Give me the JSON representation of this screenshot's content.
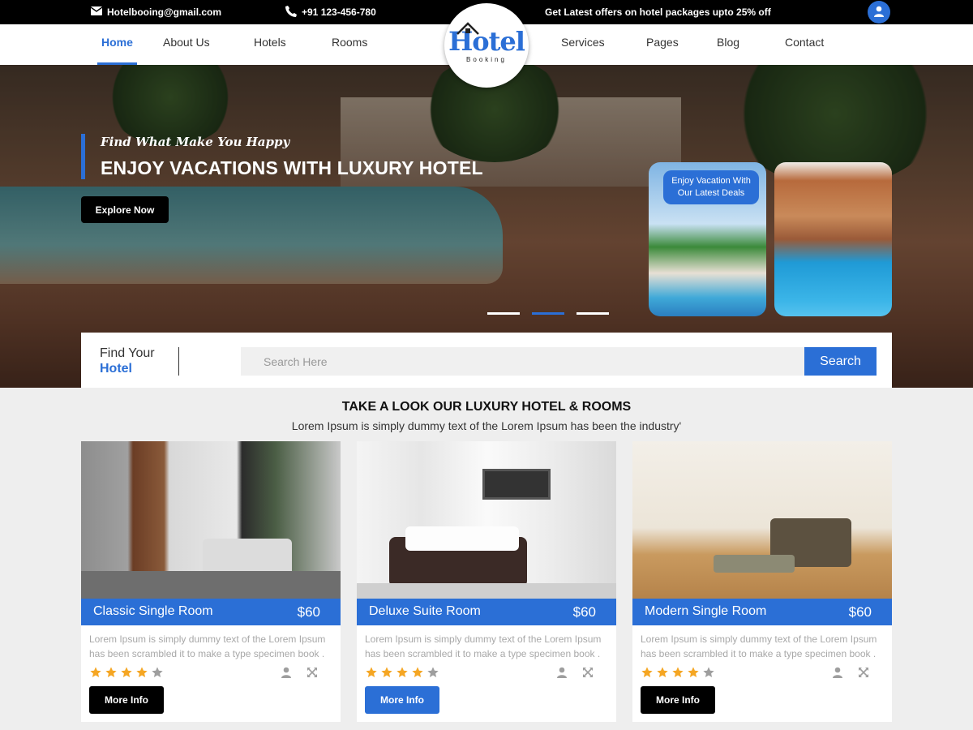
{
  "topbar": {
    "email": "Hotelbooing@gmail.com",
    "phone": "+91 123-456-780",
    "offer": "Get Latest offers on hotel packages upto 25% off"
  },
  "nav": {
    "items": [
      "Home",
      "About Us",
      "Hotels",
      "Rooms",
      "Services",
      "Pages",
      "Blog",
      "Contact"
    ],
    "active": "Home"
  },
  "logo": {
    "word": "Hotel",
    "sub": "Booking"
  },
  "hero": {
    "tagline": "Find What Make You Happy",
    "headline": "ENJOY VACATIONS WITH LUXURY HOTEL",
    "cta": "Explore Now",
    "deal_badge": "Enjoy Vacation With Our Latest Deals",
    "slide_count": 3,
    "active_slide": 2
  },
  "search": {
    "label_line1": "Find Your",
    "label_line2": "Hotel",
    "placeholder": "Search Here",
    "button": "Search"
  },
  "section": {
    "title": "TAKE A LOOK OUR LUXURY HOTEL & ROOMS",
    "subtitle": "Lorem Ipsum is simply dummy text of the Lorem Ipsum has been the industry'"
  },
  "rooms": [
    {
      "name": "Classic Single Room",
      "price": "$60",
      "desc": "Lorem Ipsum is simply dummy text of the Lorem Ipsum has been scrambled it to make a type specimen book .",
      "rating": 4,
      "button": "More Info",
      "button_color": "#000000"
    },
    {
      "name": "Deluxe Suite Room",
      "price": "$60",
      "desc": "Lorem Ipsum is simply dummy text of the Lorem Ipsum has been scrambled it to make a type specimen book .",
      "rating": 4,
      "button": "More Info",
      "button_color": "#2b6fd6"
    },
    {
      "name": "Modern Single Room",
      "price": "$60",
      "desc": "Lorem Ipsum is simply dummy text of the Lorem Ipsum has been scrambled it to make a type specimen book .",
      "rating": 4,
      "button": "More Info",
      "button_color": "#000000"
    }
  ],
  "colors": {
    "accent": "#2b6fd6",
    "star": "#f5a623",
    "star_empty": "#9e9e9e"
  }
}
